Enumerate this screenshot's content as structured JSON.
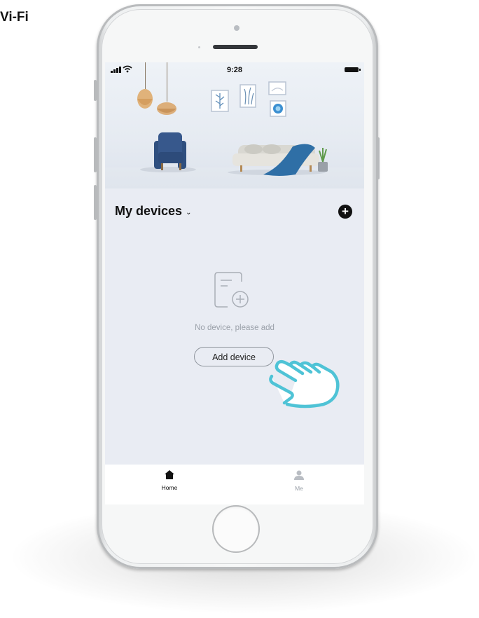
{
  "corner_label": "Vi-Fi",
  "status_bar": {
    "time": "9:28"
  },
  "screen": {
    "title": "My devices",
    "empty_message": "No device, please add",
    "add_button_label": "Add device"
  },
  "tabbar": {
    "tabs": [
      {
        "label": "Home",
        "icon": "home-icon",
        "active": true
      },
      {
        "label": "Me",
        "icon": "person-icon",
        "active": false
      }
    ]
  },
  "colors": {
    "screen_background": "#e9ecf3",
    "accent": "#111111",
    "hint_text": "#9ba1aa",
    "pointer_hand": "#4fc3d6"
  }
}
